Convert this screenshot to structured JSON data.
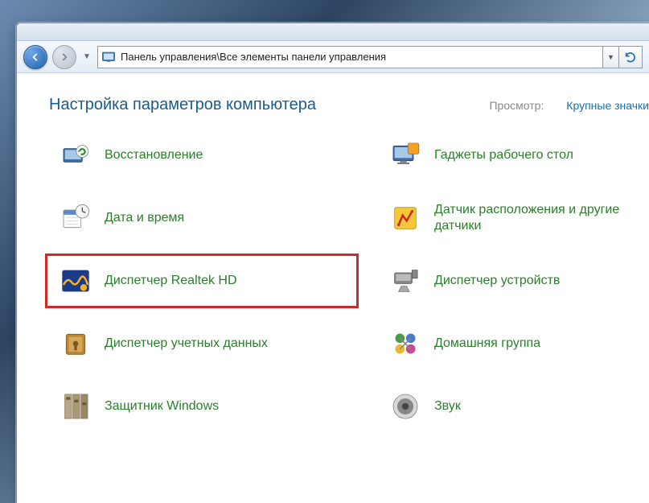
{
  "address": "Панель управления\\Все элементы панели управления",
  "page_title": "Настройка параметров компьютера",
  "view_label": "Просмотр:",
  "view_value": "Крупные значки",
  "left_items": [
    {
      "label": "Восстановление",
      "icon": "recovery"
    },
    {
      "label": "Дата и время",
      "icon": "datetime"
    },
    {
      "label": "Диспетчер Realtek HD",
      "icon": "realtek",
      "highlighted": true
    },
    {
      "label": "Диспетчер учетных данных",
      "icon": "creds"
    },
    {
      "label": "Защитник Windows",
      "icon": "defender"
    }
  ],
  "right_items": [
    {
      "label": "Гаджеты рабочего стол",
      "icon": "gadgets"
    },
    {
      "label": "Датчик расположения и другие датчики",
      "icon": "sensor"
    },
    {
      "label": "Диспетчер устройств",
      "icon": "devices"
    },
    {
      "label": "Домашняя группа",
      "icon": "homegroup"
    },
    {
      "label": "Звук",
      "icon": "sound"
    }
  ]
}
